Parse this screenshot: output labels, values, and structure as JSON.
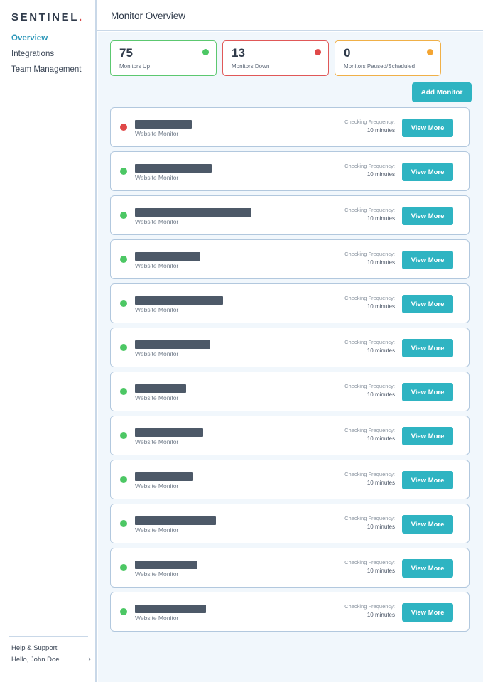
{
  "app": {
    "logo_text": "SENTINEL",
    "logo_dot": "."
  },
  "sidebar": {
    "items": [
      {
        "label": "Overview",
        "active": true
      },
      {
        "label": "Integrations",
        "active": false
      },
      {
        "label": "Team Management",
        "active": false
      }
    ],
    "help_label": "Help & Support",
    "user_greeting": "Hello, John Doe",
    "user_chevron": "›"
  },
  "header": {
    "title": "Monitor Overview"
  },
  "stats": {
    "up": {
      "value": "75",
      "label": "Monitors Up",
      "color": "#4cc764"
    },
    "down": {
      "value": "13",
      "label": "Monitors Down",
      "color": "#e04848"
    },
    "paused": {
      "value": "0",
      "label": "Monitors Paused/Scheduled",
      "color": "#f4a532"
    }
  },
  "toolbar": {
    "add_label": "Add Monitor"
  },
  "monitors": [
    {
      "status": "down",
      "type": "Website Monitor",
      "frequency_label": "Checking Frequency:",
      "frequency": "10 minutes",
      "action": "View More"
    },
    {
      "status": "up",
      "type": "Website Monitor",
      "frequency_label": "Checking Frequency:",
      "frequency": "10 minutes",
      "action": "View More"
    },
    {
      "status": "up",
      "type": "Website Monitor",
      "frequency_label": "Checking Frequency:",
      "frequency": "10 minutes",
      "action": "View More"
    },
    {
      "status": "up",
      "type": "Website Monitor",
      "frequency_label": "Checking Frequency:",
      "frequency": "10 minutes",
      "action": "View More"
    },
    {
      "status": "up",
      "type": "Website Monitor",
      "frequency_label": "Checking Frequency:",
      "frequency": "10 minutes",
      "action": "View More"
    },
    {
      "status": "up",
      "type": "Website Monitor",
      "frequency_label": "Checking Frequency:",
      "frequency": "10 minutes",
      "action": "View More"
    },
    {
      "status": "up",
      "type": "Website Monitor",
      "frequency_label": "Checking Frequency:",
      "frequency": "10 minutes",
      "action": "View More"
    },
    {
      "status": "up",
      "type": "Website Monitor",
      "frequency_label": "Checking Frequency:",
      "frequency": "10 minutes",
      "action": "View More"
    },
    {
      "status": "up",
      "type": "Website Monitor",
      "frequency_label": "Checking Frequency:",
      "frequency": "10 minutes",
      "action": "View More"
    },
    {
      "status": "up",
      "type": "Website Monitor",
      "frequency_label": "Checking Frequency:",
      "frequency": "10 minutes",
      "action": "View More"
    },
    {
      "status": "up",
      "type": "Website Monitor",
      "frequency_label": "Checking Frequency:",
      "frequency": "10 minutes",
      "action": "View More"
    },
    {
      "status": "up",
      "type": "Website Monitor",
      "frequency_label": "Checking Frequency:",
      "frequency": "10 minutes",
      "action": "View More"
    }
  ]
}
